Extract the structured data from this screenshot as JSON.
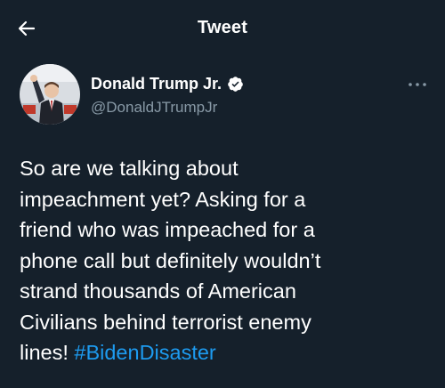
{
  "header": {
    "title": "Tweet",
    "back_icon": "arrow-left-icon"
  },
  "author": {
    "display_name": "Donald Trump Jr.",
    "handle": "@DonaldJTrumpJr",
    "verified_icon": "verified-badge-icon",
    "more_icon": "more-horizontal-icon"
  },
  "tweet": {
    "text": "So are we talking about\nimpeachment yet? Asking for a\nfriend who was impeached for a\nphone call but definitely wouldn’t\nstrand thousands of American\nCivilians behind terrorist enemy\nlines! ",
    "hashtag": "#BidenDisaster"
  },
  "colors": {
    "background": "#15202b",
    "text": "#ffffff",
    "secondary_text": "#8899a6",
    "accent": "#1d9bf0"
  }
}
